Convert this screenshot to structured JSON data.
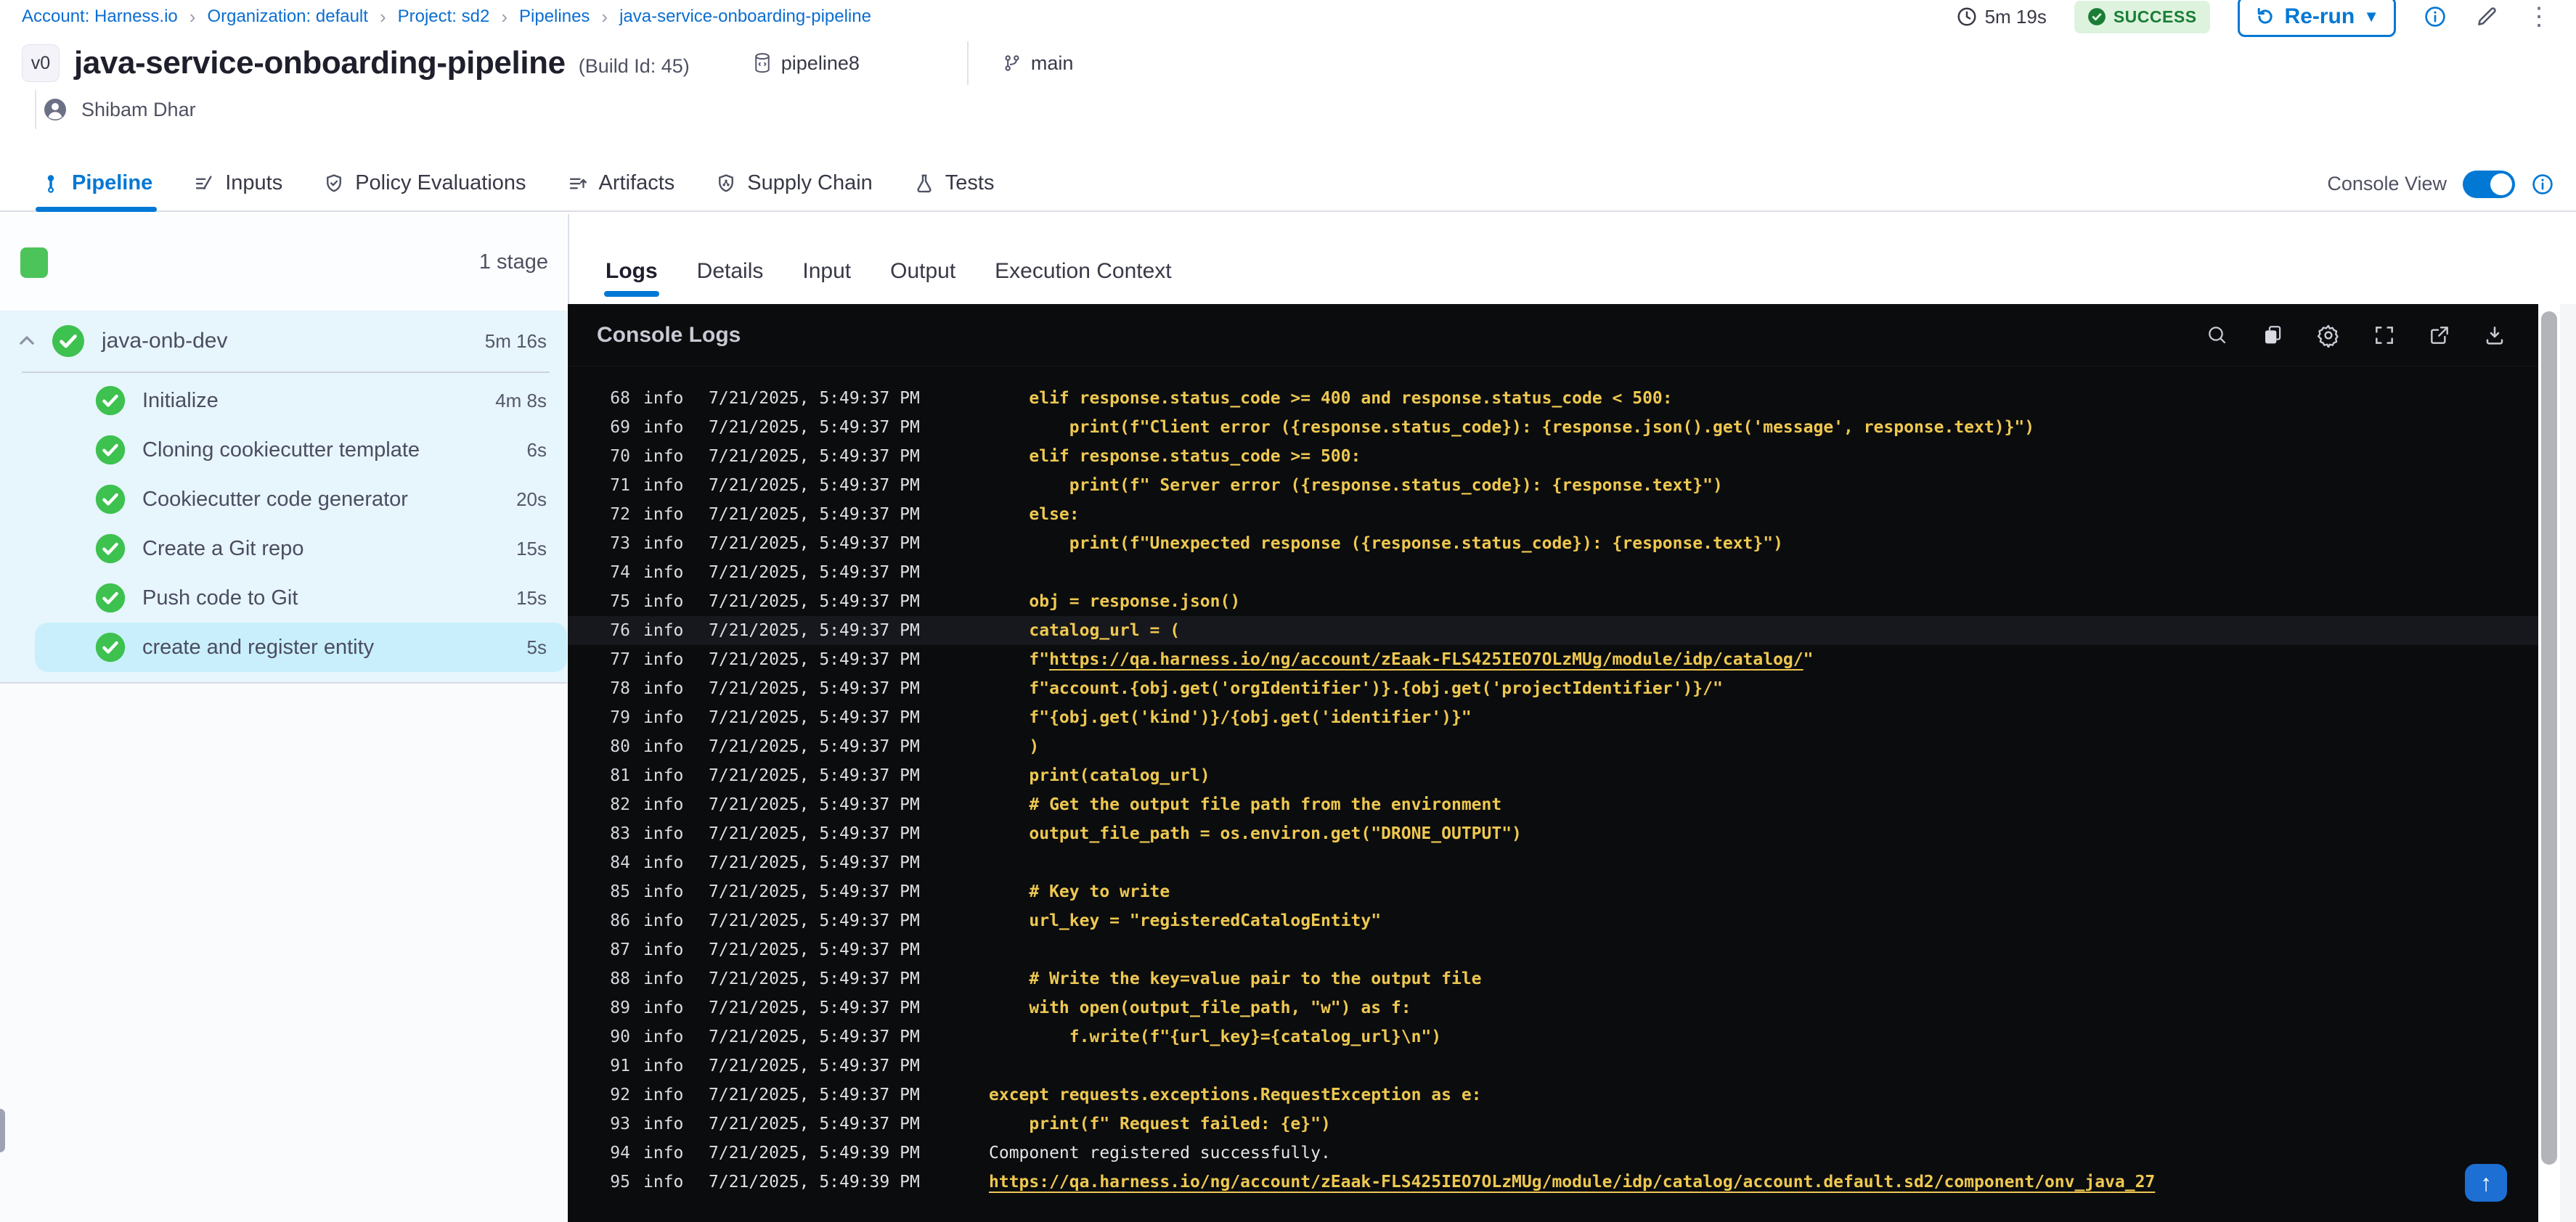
{
  "breadcrumb": {
    "separator": "›",
    "items": [
      "Account: Harness.io",
      "Organization: default",
      "Project: sd2",
      "Pipelines",
      "java-service-onboarding-pipeline"
    ]
  },
  "topbar": {
    "duration": "5m 19s",
    "status": "SUCCESS",
    "rerun": "Re-run"
  },
  "header": {
    "version_badge": "v0",
    "title": "java-service-onboarding-pipeline",
    "build_id": "(Build Id: 45)",
    "pipeline_tag": "pipeline8",
    "branch": "main",
    "user": "Shibam Dhar"
  },
  "nav_tabs": [
    {
      "label": "Pipeline",
      "active": true
    },
    {
      "label": "Inputs",
      "active": false
    },
    {
      "label": "Policy Evaluations",
      "active": false
    },
    {
      "label": "Artifacts",
      "active": false
    },
    {
      "label": "Supply Chain",
      "active": false
    },
    {
      "label": "Tests",
      "active": false
    }
  ],
  "console_view": {
    "label": "Console View",
    "enabled": true
  },
  "sidebar": {
    "stage_count": "1 stage",
    "stage": {
      "name": "java-onb-dev",
      "duration": "5m 16s"
    },
    "steps": [
      {
        "label": "Initialize",
        "duration": "4m 8s",
        "selected": false
      },
      {
        "label": "Cloning cookiecutter template",
        "duration": "6s",
        "selected": false
      },
      {
        "label": "Cookiecutter code generator",
        "duration": "20s",
        "selected": false
      },
      {
        "label": "Create a Git repo",
        "duration": "15s",
        "selected": false
      },
      {
        "label": "Push code to Git",
        "duration": "15s",
        "selected": false
      },
      {
        "label": "create and register entity",
        "duration": "5s",
        "selected": true
      }
    ]
  },
  "panel": {
    "tabs": [
      {
        "label": "Logs",
        "active": true
      },
      {
        "label": "Details",
        "active": false
      },
      {
        "label": "Input",
        "active": false
      },
      {
        "label": "Output",
        "active": false
      },
      {
        "label": "Execution Context",
        "active": false
      }
    ],
    "console_title": "Console Logs",
    "toolbar_icons": [
      "search",
      "copy",
      "settings",
      "fullscreen",
      "open-in-new",
      "download"
    ]
  },
  "logs": {
    "entries": [
      {
        "n": "68",
        "level": "info",
        "time": "7/21/2025, 5:49:37 PM",
        "seg": [
          [
            "code",
            "    elif response.status_code >= 400 and response.status_code < 500:"
          ]
        ]
      },
      {
        "n": "69",
        "level": "info",
        "time": "7/21/2025, 5:49:37 PM",
        "seg": [
          [
            "code",
            "        print(f\"Client error ({response.status_code}): {response.json().get('message', response.text)}\")"
          ]
        ]
      },
      {
        "n": "70",
        "level": "info",
        "time": "7/21/2025, 5:49:37 PM",
        "seg": [
          [
            "code",
            "    elif response.status_code >= 500:"
          ]
        ]
      },
      {
        "n": "71",
        "level": "info",
        "time": "7/21/2025, 5:49:37 PM",
        "seg": [
          [
            "code",
            "        print(f\" Server error ({response.status_code}): {response.text}\")"
          ]
        ]
      },
      {
        "n": "72",
        "level": "info",
        "time": "7/21/2025, 5:49:37 PM",
        "seg": [
          [
            "code",
            "    else:"
          ]
        ]
      },
      {
        "n": "73",
        "level": "info",
        "time": "7/21/2025, 5:49:37 PM",
        "seg": [
          [
            "code",
            "        print(f\"Unexpected response ({response.status_code}): {response.text}\")"
          ]
        ]
      },
      {
        "n": "74",
        "level": "info",
        "time": "7/21/2025, 5:49:37 PM",
        "seg": []
      },
      {
        "n": "75",
        "level": "info",
        "time": "7/21/2025, 5:49:37 PM",
        "seg": [
          [
            "code",
            "    obj = response.json()"
          ]
        ]
      },
      {
        "n": "76",
        "level": "info",
        "time": "7/21/2025, 5:49:37 PM",
        "highlight": true,
        "seg": [
          [
            "code",
            "    catalog_url = ("
          ]
        ]
      },
      {
        "n": "77",
        "level": "info",
        "time": "7/21/2025, 5:49:37 PM",
        "seg": [
          [
            "code",
            "    f\""
          ],
          [
            "link",
            "https://qa.harness.io/ng/account/zEaak-FLS425IEO7OLzMUg/module/idp/catalog/"
          ],
          [
            "code",
            "\""
          ]
        ]
      },
      {
        "n": "78",
        "level": "info",
        "time": "7/21/2025, 5:49:37 PM",
        "seg": [
          [
            "code",
            "    f\"account.{obj.get('orgIdentifier')}.{obj.get('projectIdentifier')}/\""
          ]
        ]
      },
      {
        "n": "79",
        "level": "info",
        "time": "7/21/2025, 5:49:37 PM",
        "seg": [
          [
            "code",
            "    f\"{obj.get('kind')}/{obj.get('identifier')}\""
          ]
        ]
      },
      {
        "n": "80",
        "level": "info",
        "time": "7/21/2025, 5:49:37 PM",
        "seg": [
          [
            "code",
            "    )"
          ]
        ]
      },
      {
        "n": "81",
        "level": "info",
        "time": "7/21/2025, 5:49:37 PM",
        "seg": [
          [
            "code",
            "    print(catalog_url)"
          ]
        ]
      },
      {
        "n": "82",
        "level": "info",
        "time": "7/21/2025, 5:49:37 PM",
        "seg": [
          [
            "code",
            "    # Get the output file path from the environment"
          ]
        ]
      },
      {
        "n": "83",
        "level": "info",
        "time": "7/21/2025, 5:49:37 PM",
        "seg": [
          [
            "code",
            "    output_file_path = os.environ.get(\"DRONE_OUTPUT\")"
          ]
        ]
      },
      {
        "n": "84",
        "level": "info",
        "time": "7/21/2025, 5:49:37 PM",
        "seg": []
      },
      {
        "n": "85",
        "level": "info",
        "time": "7/21/2025, 5:49:37 PM",
        "seg": [
          [
            "code",
            "    # Key to write"
          ]
        ]
      },
      {
        "n": "86",
        "level": "info",
        "time": "7/21/2025, 5:49:37 PM",
        "seg": [
          [
            "code",
            "    url_key = \"registeredCatalogEntity\""
          ]
        ]
      },
      {
        "n": "87",
        "level": "info",
        "time": "7/21/2025, 5:49:37 PM",
        "seg": []
      },
      {
        "n": "88",
        "level": "info",
        "time": "7/21/2025, 5:49:37 PM",
        "seg": [
          [
            "code",
            "    # Write the key=value pair to the output file"
          ]
        ]
      },
      {
        "n": "89",
        "level": "info",
        "time": "7/21/2025, 5:49:37 PM",
        "seg": [
          [
            "code",
            "    with open(output_file_path, \"w\") as f:"
          ]
        ]
      },
      {
        "n": "90",
        "level": "info",
        "time": "7/21/2025, 5:49:37 PM",
        "seg": [
          [
            "code",
            "        f.write(f\"{url_key}={catalog_url}\\n\")"
          ]
        ]
      },
      {
        "n": "91",
        "level": "info",
        "time": "7/21/2025, 5:49:37 PM",
        "seg": []
      },
      {
        "n": "92",
        "level": "info",
        "time": "7/21/2025, 5:49:37 PM",
        "seg": [
          [
            "code",
            "except requests.exceptions.RequestException as e:"
          ]
        ]
      },
      {
        "n": "93",
        "level": "info",
        "time": "7/21/2025, 5:49:37 PM",
        "seg": [
          [
            "code",
            "    print(f\" Request failed: {e}\")"
          ]
        ]
      },
      {
        "n": "94",
        "level": "info",
        "time": "7/21/2025, 5:49:39 PM",
        "seg": [
          [
            "plain",
            "Component registered successfully."
          ]
        ]
      },
      {
        "n": "95",
        "level": "info",
        "time": "7/21/2025, 5:49:39 PM",
        "seg": [
          [
            "link",
            "https://qa.harness.io/ng/account/zEaak-FLS425IEO7OLzMUg/module/idp/catalog/account.default.sd2/component/onv_java_27"
          ]
        ]
      }
    ]
  },
  "colors": {
    "accent": "#0278d5",
    "success_green": "#3dc14f",
    "log_yellow": "#eec850",
    "console_bg": "#0b0c0e",
    "sidebar_section": "#e7f5fc",
    "sidebar_selected": "#c9effc"
  }
}
